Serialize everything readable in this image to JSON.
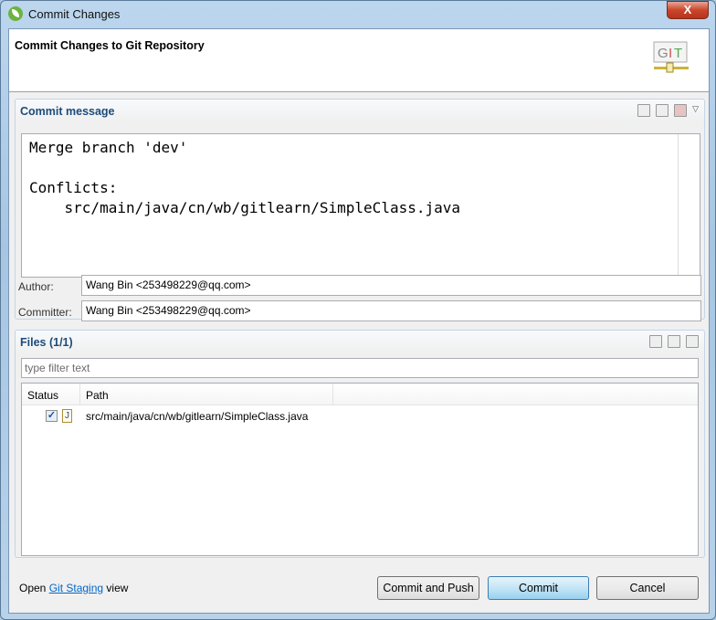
{
  "window": {
    "title": "Commit Changes",
    "close_label": "X"
  },
  "header": {
    "title": "Commit Changes to Git Repository",
    "logo_text": "GIT"
  },
  "commit_message": {
    "label": "Commit message",
    "text": "Merge branch 'dev'\n\nConflicts:\n    src/main/java/cn/wb/gitlearn/SimpleClass.java"
  },
  "author": {
    "label": "Author:",
    "value": "Wang Bin <253498229@qq.com>"
  },
  "committer": {
    "label": "Committer:",
    "value": "Wang Bin <253498229@qq.com>"
  },
  "files": {
    "label": "Files (1/1)",
    "filter_placeholder": "type filter text",
    "columns": [
      "Status",
      "Path"
    ],
    "rows": [
      {
        "checked": true,
        "path": "src/main/java/cn/wb/gitlearn/SimpleClass.java"
      }
    ]
  },
  "footer": {
    "open": "Open",
    "link": "Git Staging",
    "view": "view"
  },
  "buttons": {
    "commit_push": "Commit and Push",
    "commit": "Commit",
    "cancel": "Cancel"
  }
}
